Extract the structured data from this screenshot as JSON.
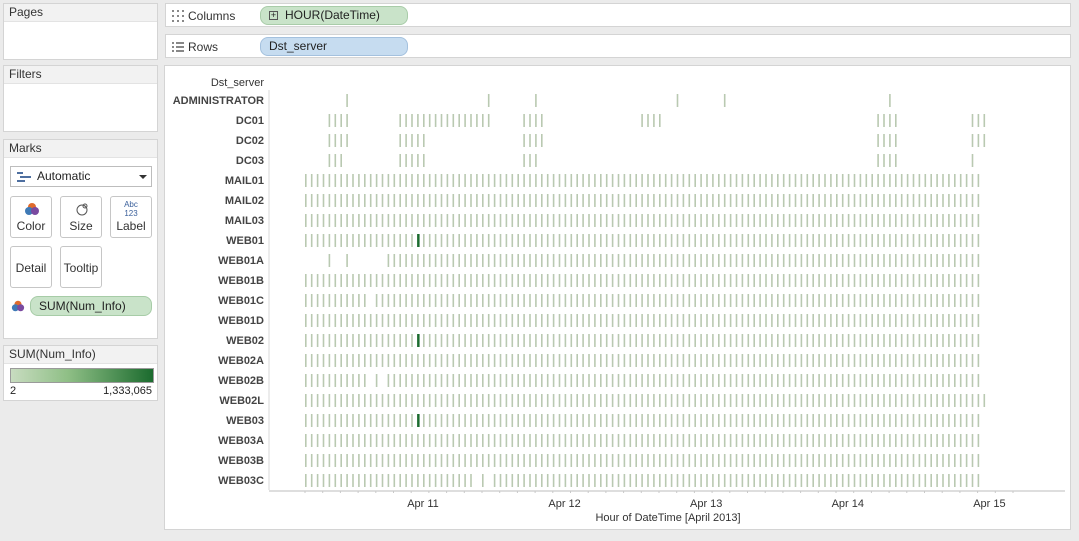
{
  "panels": {
    "pages_title": "Pages",
    "filters_title": "Filters",
    "marks_title": "Marks",
    "mark_type": "Automatic",
    "buttons": {
      "color": "Color",
      "size": "Size",
      "label": "Label",
      "label_icon_text": "Abc 123",
      "detail": "Detail",
      "tooltip": "Tooltip"
    },
    "color_field": "SUM(Num_Info)"
  },
  "legend": {
    "title": "SUM(Num_Info)",
    "min_label": "2",
    "max_label": "1,333,065",
    "colors": {
      "low": "#c8dcc0",
      "high": "#1b6b2e"
    }
  },
  "shelves": {
    "columns_label": "Columns",
    "columns_pill": "HOUR(DateTime)",
    "rows_label": "Rows",
    "rows_pill": "Dst_server"
  },
  "chart_data": {
    "type": "heatmap",
    "row_header": "Dst_server",
    "xlabel": "Hour of DateTime [April 2013]",
    "x_ticks": [
      "Apr 11",
      "Apr 12",
      "Apr 13",
      "Apr 14",
      "Apr 15"
    ],
    "colors": {
      "low": "#c8dcc0",
      "high": "#1b6b2e"
    },
    "rows": [
      {
        "name": "ADMINISTRATOR",
        "hours": "2013-04-10 23:00, 2013-04-11 23:00, 2013-04-12 07:00, 2013-04-13 07:00, 2013-04-13 15:00, 2013-04-14 19:00"
      },
      {
        "name": "DC01",
        "hours": "2013-04-10 20:00–2013-04-10 23:00, 2013-04-11 08:00–2013-04-11 23:00, 2013-04-12 05:00–2013-04-12 08:00, 2013-04-13 01:00–2013-04-13 04:00, 2013-04-14 17:00–2013-04-14 20:00, 2013-04-15 09:00–2013-04-15 11:00"
      },
      {
        "name": "DC02",
        "hours": "2013-04-10 20:00–2013-04-10 23:00, 2013-04-11 08:00–2013-04-11 12:00, 2013-04-12 05:00–2013-04-12 08:00, 2013-04-14 17:00–2013-04-14 20:00, 2013-04-15 09:00–2013-04-15 11:00"
      },
      {
        "name": "DC03",
        "hours": "2013-04-10 20:00–2013-04-10 22:00, 2013-04-11 08:00–2013-04-11 12:00, 2013-04-12 05:00–2013-04-12 07:00, 2013-04-14 17:00–2013-04-14 20:00, 2013-04-15 09:00"
      },
      {
        "name": "MAIL01",
        "hours": "2013-04-10 16:00 – 2013-04-15 10:00, hourly"
      },
      {
        "name": "MAIL02",
        "hours": "2013-04-10 16:00 – 2013-04-15 10:00, hourly"
      },
      {
        "name": "MAIL03",
        "hours": "2013-04-10 16:00 – 2013-04-15 10:00, hourly"
      },
      {
        "name": "WEB01",
        "hours": "2013-04-10 16:00 – 2013-04-15 10:00, hourly",
        "peak": "2013-04-11 11:00"
      },
      {
        "name": "WEB01A",
        "hours": "2013-04-10 20:00, 2013-04-10 23:00, 2013-04-11 06:00 – 2013-04-15 10:00 hourly"
      },
      {
        "name": "WEB01B",
        "hours": "2013-04-10 16:00 – 2013-04-15 10:00, hourly"
      },
      {
        "name": "WEB01C",
        "hours": "2013-04-10 16:00 – 2013-04-15 10:00, hourly, gap at 2013-04-11 03:00"
      },
      {
        "name": "WEB01D",
        "hours": "2013-04-10 16:00 – 2013-04-15 10:00, hourly"
      },
      {
        "name": "WEB02",
        "hours": "2013-04-10 16:00 – 2013-04-15 10:00, hourly",
        "peak": "2013-04-11 11:00"
      },
      {
        "name": "WEB02A",
        "hours": "2013-04-10 16:00 – 2013-04-15 10:00, hourly"
      },
      {
        "name": "WEB02B",
        "hours": "2013-04-10 16:00 – 2013-04-15 10:00, hourly, gaps at 2013-04-11 03:00 and 2013-04-11 05:00"
      },
      {
        "name": "WEB02L",
        "hours": "2013-04-10 16:00 – 2013-04-15 11:00, hourly"
      },
      {
        "name": "WEB03",
        "hours": "2013-04-10 16:00 – 2013-04-15 10:00, hourly",
        "peak": "2013-04-11 11:00"
      },
      {
        "name": "WEB03A",
        "hours": "2013-04-10 16:00 – 2013-04-15 10:00, hourly"
      },
      {
        "name": "WEB03B",
        "hours": "2013-04-10 16:00 – 2013-04-15 10:00, hourly"
      },
      {
        "name": "WEB03C",
        "hours": "2013-04-10 16:00 – 2013-04-15 10:00, hourly, gaps at 2013-04-11 21:00 and 2013-04-11 23:00"
      }
    ]
  }
}
